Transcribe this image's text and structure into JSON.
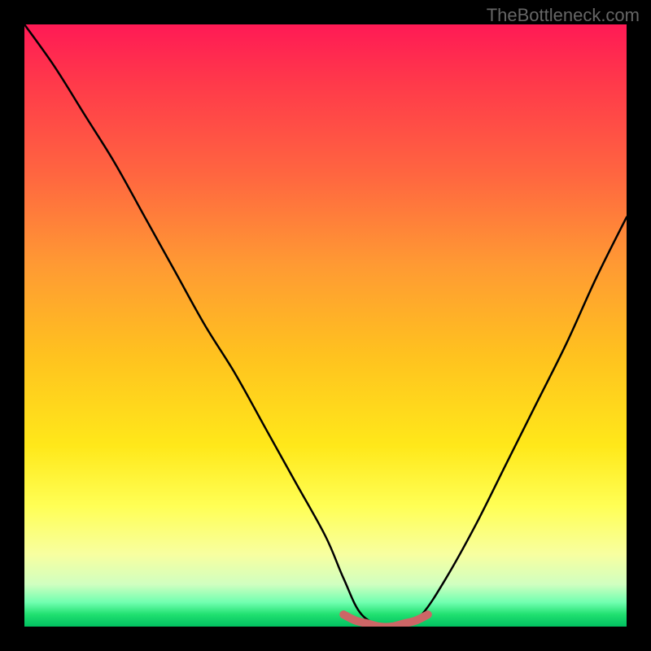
{
  "watermark": "TheBottleneck.com",
  "chart_data": {
    "type": "line",
    "title": "",
    "xlabel": "",
    "ylabel": "",
    "xlim": [
      0,
      100
    ],
    "ylim": [
      0,
      100
    ],
    "series": [
      {
        "name": "bottleneck-curve",
        "x": [
          0,
          5,
          10,
          15,
          20,
          25,
          30,
          35,
          40,
          45,
          50,
          53,
          56,
          60,
          63,
          66,
          70,
          75,
          80,
          85,
          90,
          95,
          100
        ],
        "values": [
          100,
          93,
          85,
          77,
          68,
          59,
          50,
          42,
          33,
          24,
          15,
          8,
          2,
          0,
          0,
          2,
          8,
          17,
          27,
          37,
          47,
          58,
          68
        ]
      },
      {
        "name": "valley-marker",
        "x": [
          53,
          55,
          57,
          59,
          61,
          63,
          65,
          67
        ],
        "values": [
          2,
          1,
          0.5,
          0,
          0,
          0.5,
          1,
          2
        ]
      }
    ]
  }
}
